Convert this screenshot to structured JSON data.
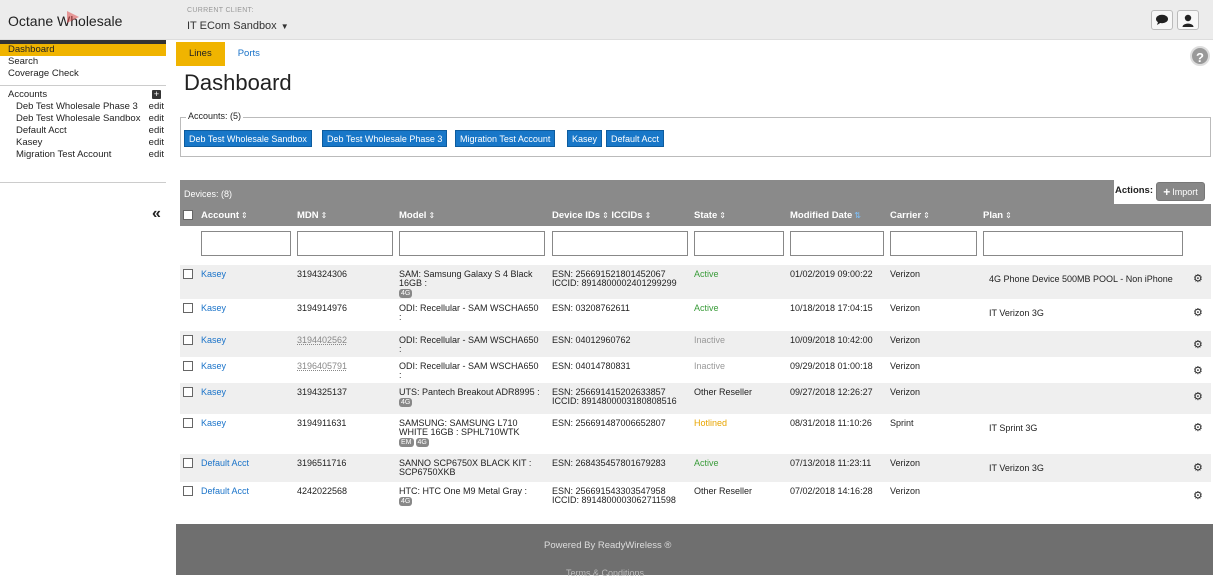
{
  "header": {
    "brand": "Octane Wholesale",
    "client_label": "CURRENT CLIENT:",
    "client_value": "IT ECom Sandbox"
  },
  "sidebar": {
    "nav": [
      "Dashboard",
      "Search",
      "Coverage Check"
    ],
    "accounts_title": "Accounts",
    "accounts": [
      {
        "name": "Deb Test Wholesale Phase 3",
        "edit": "edit"
      },
      {
        "name": "Deb Test Wholesale Sandbox",
        "edit": "edit"
      },
      {
        "name": "Default Acct",
        "edit": "edit"
      },
      {
        "name": "Kasey",
        "edit": "edit"
      },
      {
        "name": "Migration Test Account",
        "edit": "edit"
      }
    ]
  },
  "tabs": [
    "Lines",
    "Ports"
  ],
  "page_title": "Dashboard",
  "accounts_box": {
    "legend": "Accounts: (5)",
    "chips": [
      "Deb Test Wholesale Sandbox",
      "Deb Test Wholesale Phase 3",
      "Migration Test Account",
      "Kasey",
      "Default Acct"
    ]
  },
  "devices": {
    "label": "Devices: (8)",
    "actions_label": "Actions:",
    "import_label": "Import",
    "columns": {
      "account": "Account",
      "mdn": "MDN",
      "model": "Model",
      "device_ids": "Device IDs",
      "iccids": "ICCIDs",
      "state": "State",
      "modified": "Modified Date",
      "carrier": "Carrier",
      "plan": "Plan"
    },
    "rows": [
      {
        "account": "Kasey",
        "mdn": "3194324306",
        "model1": "SAM: Samsung Galaxy S 4 Black",
        "model2": "16GB :",
        "badges": [
          "4G"
        ],
        "esn": "ESN: 256691521801452067",
        "iccid": "ICCID: 8914800002401299299",
        "state": "Active",
        "modified": "01/02/2019 09:00:22",
        "carrier": "Verizon",
        "plan": "4G Phone Device 500MB POOL - Non iPhone"
      },
      {
        "account": "Kasey",
        "mdn": "3194914976",
        "model1": "ODI: Recellular - SAM WSCHA650",
        "model2": ":",
        "badges": [],
        "esn": "ESN: 03208762611",
        "iccid": "",
        "state": "Active",
        "modified": "10/18/2018 17:04:15",
        "carrier": "Verizon",
        "plan": "IT Verizon 3G"
      },
      {
        "account": "Kasey",
        "mdn": "3194402562",
        "model1": "ODI: Recellular - SAM WSCHA650",
        "model2": ":",
        "badges": [],
        "esn": "ESN: 04012960762",
        "iccid": "",
        "state": "Inactive",
        "modified": "10/09/2018 10:42:00",
        "carrier": "Verizon",
        "plan": ""
      },
      {
        "account": "Kasey",
        "mdn": "3196405791",
        "model1": "ODI: Recellular - SAM WSCHA650",
        "model2": ":",
        "badges": [],
        "esn": "ESN: 04014780831",
        "iccid": "",
        "state": "Inactive",
        "modified": "09/29/2018 01:00:18",
        "carrier": "Verizon",
        "plan": ""
      },
      {
        "account": "Kasey",
        "mdn": "3194325137",
        "model1": "UTS: Pantech Breakout ADR8995 :",
        "model2": "",
        "badges": [
          "4G"
        ],
        "esn": "ESN: 256691415202633857",
        "iccid": "ICCID: 8914800003180808516",
        "state": "Other Reseller",
        "modified": "09/27/2018 12:26:27",
        "carrier": "Verizon",
        "plan": ""
      },
      {
        "account": "Kasey",
        "mdn": "3194911631",
        "model1": "SAMSUNG: SAMSUNG L710",
        "model2": "WHITE 16GB : SPHL710WTK",
        "badges": [
          "EM",
          "4G"
        ],
        "esn": "ESN: 256691487006652807",
        "iccid": "",
        "state": "Hotlined",
        "modified": "08/31/2018 11:10:26",
        "carrier": "Sprint",
        "plan": "IT Sprint 3G"
      },
      {
        "account": "Default Acct",
        "mdn": "3196511716",
        "model1": "SANNO SCP6750X BLACK KIT :",
        "model2": "SCP6750XKB",
        "badges": [],
        "esn": "ESN: 268435457801679283",
        "iccid": "",
        "state": "Active",
        "modified": "07/13/2018 11:23:11",
        "carrier": "Verizon",
        "plan": "IT Verizon 3G"
      },
      {
        "account": "Default Acct",
        "mdn": "4242022568",
        "model1": "HTC: HTC One M9 Metal Gray :",
        "model2": "",
        "badges": [
          "4G"
        ],
        "esn": "ESN: 256691543303547958",
        "iccid": "ICCID: 8914800003062711598",
        "state": "Other Reseller",
        "modified": "07/02/2018 14:16:28",
        "carrier": "Verizon",
        "plan": ""
      }
    ]
  },
  "footer": {
    "powered": "Powered By ReadyWireless",
    "registered": "®",
    "terms": "Terms & Conditions"
  }
}
